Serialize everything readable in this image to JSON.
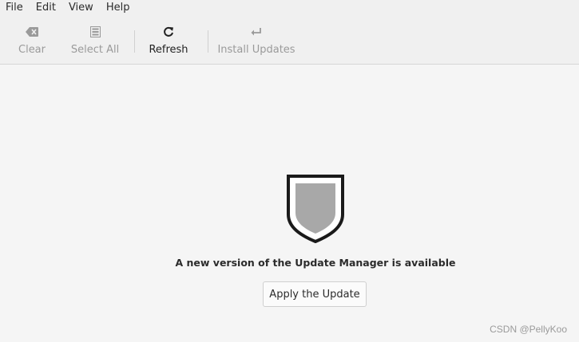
{
  "menubar": {
    "items": [
      "File",
      "Edit",
      "View",
      "Help"
    ]
  },
  "toolbar": {
    "clear_label": "Clear",
    "select_all_label": "Select All",
    "refresh_label": "Refresh",
    "install_updates_label": "Install Updates",
    "icons": {
      "clear": "backspace-icon",
      "select_all": "select-all-icon",
      "refresh": "refresh-icon",
      "install_updates": "return-arrow-icon"
    }
  },
  "main": {
    "shield_icon": "shield-icon",
    "message": "A new version of the Update Manager is available",
    "apply_button_label": "Apply the Update"
  },
  "watermark": "CSDN @PellyKoo",
  "colors": {
    "shield_outline": "#1a1a1a",
    "shield_fill": "#a8a8a8",
    "background": "#f5f5f5",
    "toolbar_bg": "#f0f0f0"
  }
}
